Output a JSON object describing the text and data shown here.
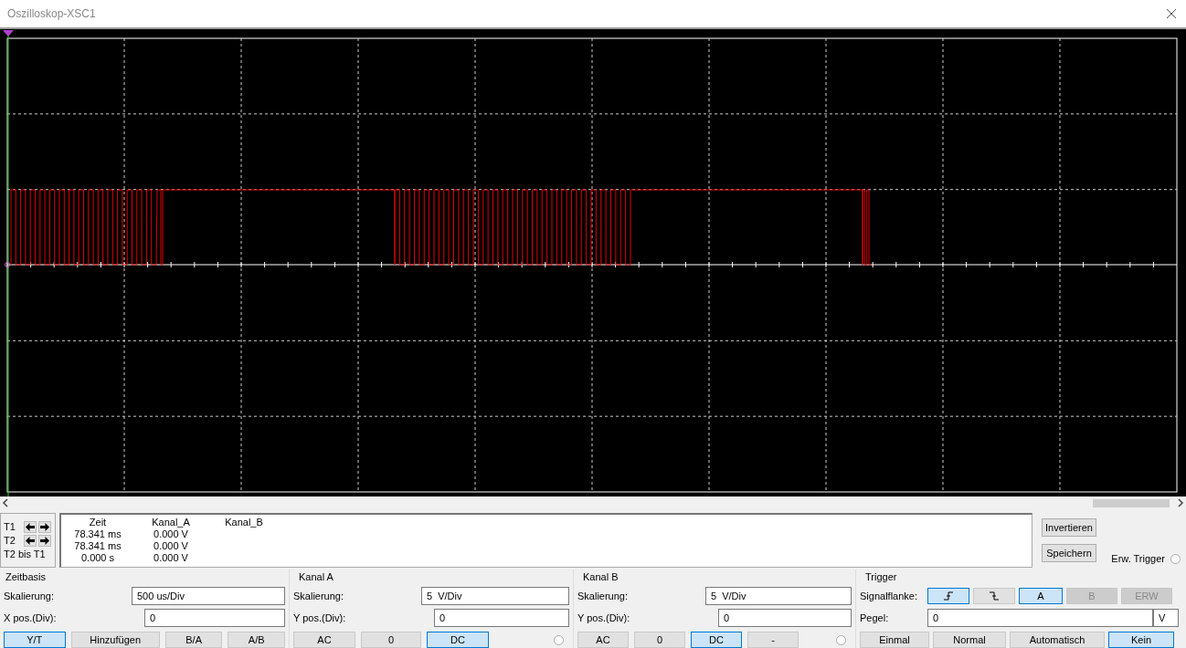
{
  "window": {
    "title": "Oszilloskop-XSC1"
  },
  "cursors": [
    {
      "label": "T1",
      "arrows": true
    },
    {
      "label": "T2",
      "arrows": true
    },
    {
      "label": "T2 bis T1",
      "arrows": false
    }
  ],
  "readout": {
    "columns": [
      "Zeit",
      "Kanal_A",
      "Kanal_B"
    ],
    "rows": [
      [
        "78.341 ms",
        "0.000 V"
      ],
      [
        "78.341 ms",
        "0.000 V"
      ],
      [
        "0.000 s",
        "0.000 V"
      ]
    ]
  },
  "side_buttons": [
    "Invertieren",
    "Speichern"
  ],
  "ext_trigger": {
    "label": "Erw. Trigger",
    "checked": false
  },
  "timebase": {
    "title": "Zeitbasis",
    "scale_label": "Skalierung:",
    "scale_value": "500 us/Div",
    "pos_label": "X pos.(Div):",
    "pos_value": "0",
    "modes": [
      {
        "label": "Y/T",
        "selected": true
      },
      {
        "label": "Hinzufügen",
        "selected": false
      },
      {
        "label": "B/A",
        "selected": false
      },
      {
        "label": "A/B",
        "selected": false
      }
    ]
  },
  "channels": [
    {
      "title": "Kanal A",
      "scale_label": "Skalierung:",
      "scale_value": "5  V/Div",
      "pos_label": "Y pos.(Div):",
      "pos_value": "0",
      "radio_checked": false,
      "coupling": [
        {
          "label": "AC",
          "selected": false
        },
        {
          "label": "0",
          "selected": false
        },
        {
          "label": "DC",
          "selected": true
        }
      ]
    },
    {
      "title": "Kanal B",
      "scale_label": "Skalierung:",
      "scale_value": "5  V/Div",
      "pos_label": "Y pos.(Div):",
      "pos_value": "0",
      "radio_checked": false,
      "coupling": [
        {
          "label": "AC",
          "selected": false
        },
        {
          "label": "0",
          "selected": false
        },
        {
          "label": "DC",
          "selected": true
        },
        {
          "label": "-",
          "selected": false
        }
      ]
    }
  ],
  "trigger": {
    "title": "Trigger",
    "edge_label": "Signalflanke:",
    "edges": [
      {
        "kind": "rising",
        "selected": true
      },
      {
        "kind": "falling",
        "selected": false
      }
    ],
    "sources": [
      {
        "label": "A",
        "selected": true,
        "disabled": false
      },
      {
        "label": "B",
        "selected": false,
        "disabled": true
      },
      {
        "label": "ERW",
        "selected": false,
        "disabled": true
      }
    ],
    "level_label": "Pegel:",
    "level_value": "0",
    "level_unit": "V",
    "modes": [
      {
        "label": "Einmal",
        "selected": false
      },
      {
        "label": "Normal",
        "selected": false
      },
      {
        "label": "Automatisch",
        "selected": false
      },
      {
        "label": "Kein",
        "selected": true
      }
    ]
  }
}
